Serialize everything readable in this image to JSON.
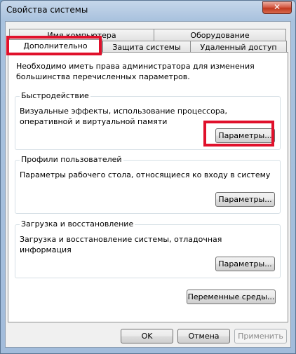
{
  "window": {
    "title": "Свойства системы",
    "close_glyph": "✕"
  },
  "tabs": [
    {
      "label": "Имя компьютера"
    },
    {
      "label": "Оборудование"
    },
    {
      "label": "Дополнительно"
    },
    {
      "label": "Защита системы"
    },
    {
      "label": "Удаленный доступ"
    }
  ],
  "panel": {
    "note": "Необходимо иметь права администратора для изменения большинства перечисленных параметров.",
    "performance": {
      "label": "Быстродействие",
      "description": "Визуальные эффекты, использование процессора, оперативной и виртуальной памяти",
      "button": "Параметры..."
    },
    "profiles": {
      "label": "Профили пользователей",
      "description": "Параметры рабочего стола, относящиеся ко входу в систему",
      "button": "Параметры..."
    },
    "startup": {
      "label": "Загрузка и восстановление",
      "description": "Загрузка и восстановление системы, отладочная информация",
      "button": "Параметры..."
    },
    "env_button": "Переменные среды..."
  },
  "footer": {
    "ok": "OK",
    "cancel": "Отмена",
    "apply": "Применить"
  },
  "colors": {
    "highlight": "#e0102b"
  }
}
